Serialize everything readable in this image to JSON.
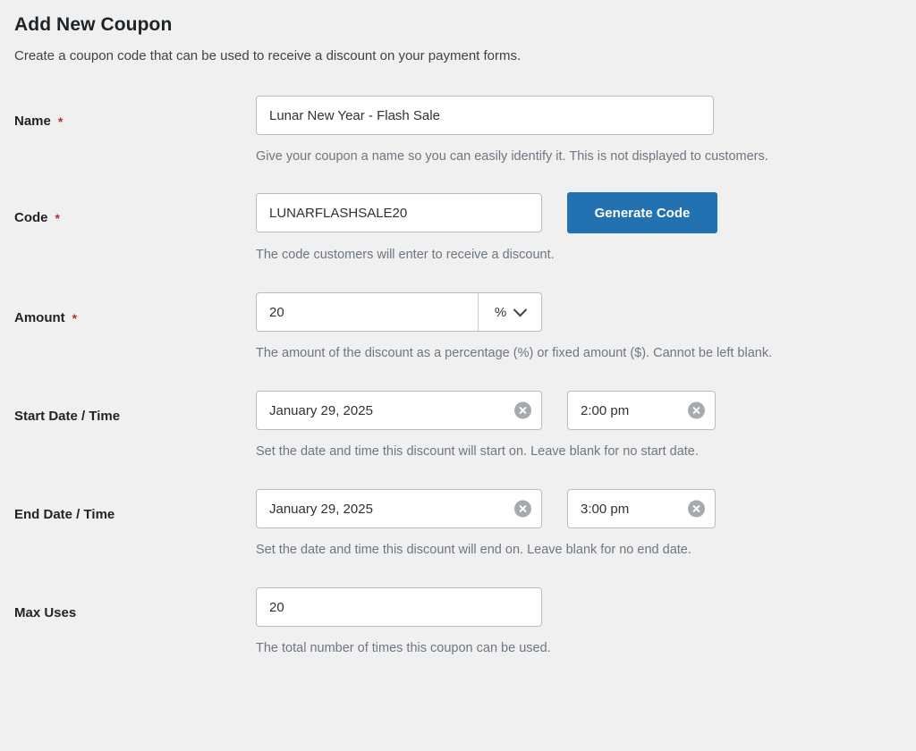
{
  "header": {
    "title": "Add New Coupon",
    "subtitle": "Create a coupon code that can be used to receive a discount on your payment forms."
  },
  "required_marker": "*",
  "colors": {
    "accent_blue": "#2271b1",
    "required_red": "#b32d2e",
    "page_background": "#f0f0f1",
    "help_text": "#6c7781",
    "clear_icon": "#a7aaad"
  },
  "fields": {
    "name": {
      "label": "Name",
      "required": true,
      "value": "Lunar New Year - Flash Sale",
      "placeholder": "",
      "help": "Give your coupon a name so you can easily identify it. This is not displayed to customers."
    },
    "code": {
      "label": "Code",
      "required": true,
      "value": "LUNARFLASHSALE20",
      "placeholder": "",
      "button_label": "Generate Code",
      "help": "The code customers will enter to receive a discount."
    },
    "amount": {
      "label": "Amount",
      "required": true,
      "value": "20",
      "unit": "%",
      "unit_options": [
        "%",
        "$"
      ],
      "help": "The amount of the discount as a percentage (%) or fixed amount ($). Cannot be left blank."
    },
    "start": {
      "label": "Start Date / Time",
      "required": false,
      "date_value": "January 29, 2025",
      "time_value": "2:00 pm",
      "help": "Set the date and time this discount will start on. Leave blank for no start date."
    },
    "end": {
      "label": "End Date / Time",
      "required": false,
      "date_value": "January 29, 2025",
      "time_value": "3:00 pm",
      "help": "Set the date and time this discount will end on. Leave blank for no end date."
    },
    "max_uses": {
      "label": "Max Uses",
      "required": false,
      "value": "20",
      "help": "The total number of times this coupon can be used."
    }
  },
  "icons": {
    "clear": "clear-circle-icon",
    "chevron": "chevron-down-icon"
  }
}
